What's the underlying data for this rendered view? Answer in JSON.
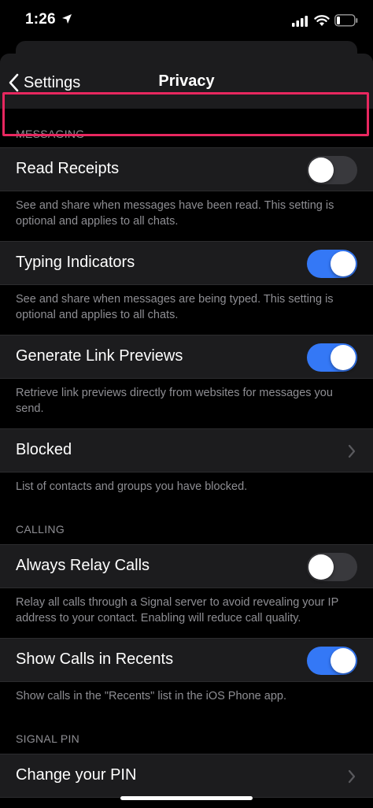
{
  "status": {
    "time": "1:26"
  },
  "nav": {
    "back_label": "Settings",
    "title": "Privacy"
  },
  "sections": {
    "messaging": "MESSAGING",
    "calling": "CALLING",
    "signal_pin": "SIGNAL PIN"
  },
  "rows": {
    "read_receipts": {
      "label": "Read Receipts",
      "enabled": false,
      "footer": "See and share when messages have been read. This setting is optional and applies to all chats."
    },
    "typing_indicators": {
      "label": "Typing Indicators",
      "enabled": true,
      "footer": "See and share when messages are being typed. This setting is optional and applies to all chats."
    },
    "link_previews": {
      "label": "Generate Link Previews",
      "enabled": true,
      "footer": "Retrieve link previews directly from websites for messages you send."
    },
    "blocked": {
      "label": "Blocked",
      "footer": "List of contacts and groups you have blocked."
    },
    "relay_calls": {
      "label": "Always Relay Calls",
      "enabled": false,
      "footer": "Relay all calls through a Signal server to avoid revealing your IP address to your contact. Enabling will reduce call quality."
    },
    "calls_in_recents": {
      "label": "Show Calls in Recents",
      "enabled": true,
      "footer": "Show calls in the \"Recents\" list in the iOS Phone app."
    },
    "change_pin": {
      "label": "Change your PIN"
    }
  },
  "colors": {
    "toggle_on": "#3478f6",
    "toggle_off": "#39393d",
    "highlight": "#e8275f",
    "row_bg": "#1c1c1e",
    "secondary_text": "#8e8e93"
  }
}
